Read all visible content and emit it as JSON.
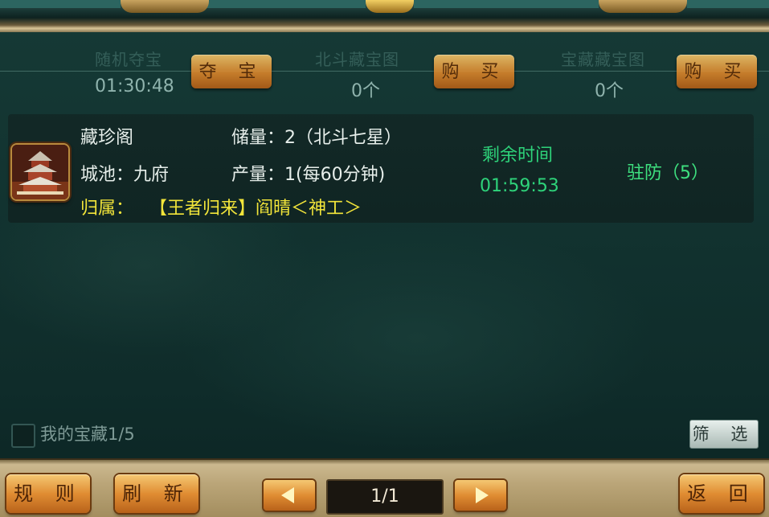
{
  "header": {
    "stats": [
      {
        "label": "随机夺宝",
        "value": "01:30:48",
        "button": "夺 宝"
      },
      {
        "label": "北斗藏宝图",
        "value": "0个",
        "button": "购 买"
      },
      {
        "label": "宝藏藏宝图",
        "value": "0个",
        "button": "购 买"
      }
    ]
  },
  "entry": {
    "name": "藏珍阁",
    "city": "城池：九府",
    "owner": "归属：",
    "owner_name": "【王者归来】阎晴＜神工＞",
    "reserve": "储量：2（北斗七星）",
    "output": "产量：1(每60分钟)",
    "remaining_label": "剩余时间",
    "remaining_time": "01:59:53",
    "garrison": "驻防（5）",
    "icon": "pagoda-icon"
  },
  "footer": {
    "my_treasure": "我的宝藏1/5",
    "filter": "筛 选",
    "rules": "规 则",
    "refresh": "刷 新",
    "page": "1/1",
    "back": "返 回"
  },
  "colors": {
    "accent_orange": "#e08d33",
    "highlight_yellow": "#f2e53a",
    "time_green": "#2ed37a",
    "panel_teal": "#143230"
  }
}
